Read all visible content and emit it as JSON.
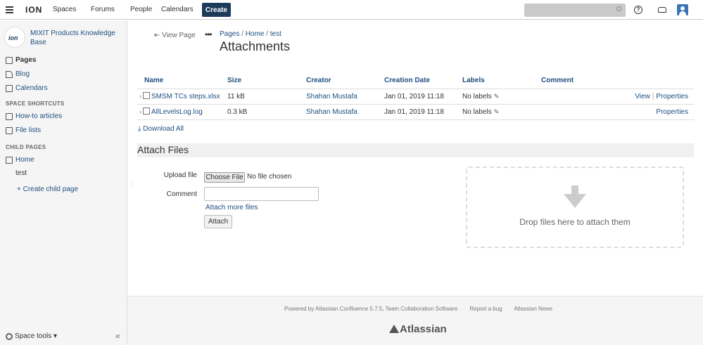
{
  "header": {
    "logo": "ION",
    "nav": [
      "Spaces",
      "Forums",
      "People",
      "Calendars"
    ],
    "create_label": "Create",
    "help_glyph": "?"
  },
  "sidebar": {
    "space_name": "MIXIT Products Knowledge Base",
    "space_logo": "ion",
    "items": [
      "Pages",
      "Blog",
      "Calendars"
    ],
    "shortcuts_heading": "SPACE SHORTCUTS",
    "shortcuts": [
      "How-to articles",
      "File lists"
    ],
    "child_heading": "CHILD PAGES",
    "child_home": "Home",
    "child_test": "test",
    "create_child": "+ Create child page",
    "space_tools": "Space tools ▾",
    "collapse_glyph": "«"
  },
  "page": {
    "view_page": "View Page",
    "breadcrumb": [
      "Pages",
      "Home",
      "test"
    ],
    "title": "Attachments"
  },
  "attachments": {
    "columns": [
      "Name",
      "Size",
      "Creator",
      "Creation Date",
      "Labels",
      "Comment"
    ],
    "rows": [
      {
        "name": "SMSM TCs steps.xlsx",
        "size": "11 kB",
        "creator": "Shahan Mustafa",
        "date": "Jan 01, 2019 11:18",
        "labels": "No labels",
        "view": "View",
        "properties": "Properties"
      },
      {
        "name": "AllLevelsLog.log",
        "size": "0.3 kB",
        "creator": "Shahan Mustafa",
        "date": "Jan 01, 2019 11:18",
        "labels": "No labels",
        "properties": "Properties"
      }
    ],
    "download_all": "Download All"
  },
  "attach_form": {
    "title": "Attach Files",
    "upload_label": "Upload file",
    "choose_btn": "Choose File",
    "no_file": "No file chosen",
    "comment_label": "Comment",
    "attach_more": "Attach more files",
    "attach_btn": "Attach",
    "drop_text": "Drop files here to attach them"
  },
  "footer": {
    "powered": "Powered by Atlassian Confluence 5.7.5, Team Collaboration Software",
    "report": "Report a bug",
    "news": "Atlassian News",
    "brand": "Atlassian"
  }
}
